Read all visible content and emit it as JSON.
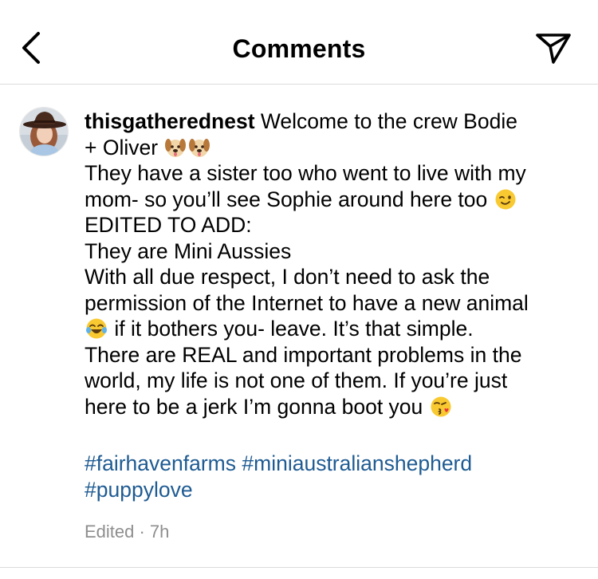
{
  "header": {
    "title": "Comments",
    "back_icon": "chevron-left-icon",
    "share_icon": "paper-plane-icon"
  },
  "comment": {
    "username": "thisgatherednest",
    "lines": {
      "l1_text": " Welcome to the crew Bodie",
      "l2_text": "+ Oliver ",
      "l3_text": "They have a sister too who went to live with my",
      "l4_text": "mom- so you’ll see Sophie around here too ",
      "l5_text": "EDITED TO ADD:",
      "l6_text": "They are Mini Aussies",
      "l7_text": "With all due respect, I don’t need to ask the",
      "l8_text": "permission of the Internet to have a new animal",
      "l9_text": " if it bothers you- leave. It’s that simple.",
      "l10_text": "There are REAL and important problems in the",
      "l11_text": "world, my life is not one of them. If you’re just",
      "l12_text": "here to be a jerk I’m gonna boot you "
    },
    "emojis": {
      "dog": "dog-face-emoji",
      "wink": "winking-face-emoji",
      "laugh": "tears-of-joy-emoji",
      "kiss": "face-blowing-kiss-emoji"
    },
    "hashtags": [
      "#fairhavenfarms",
      "#miniaustralianshepherd",
      "#puppylove"
    ],
    "meta": "Edited · 7h"
  },
  "colors": {
    "hashtag": "#1e5b92",
    "meta": "#8e8e8e",
    "divider": "#dbdbdb"
  }
}
